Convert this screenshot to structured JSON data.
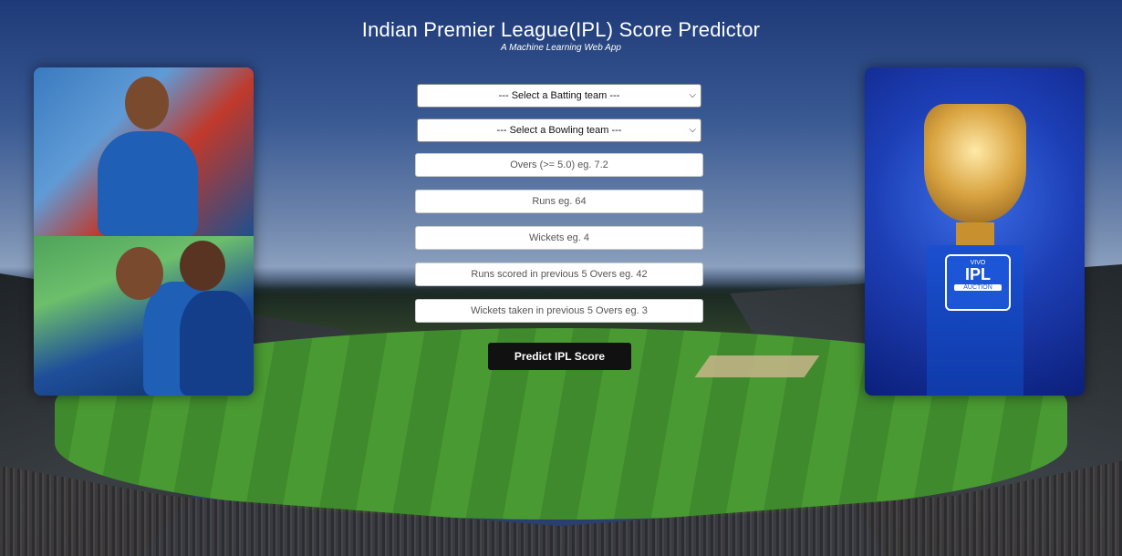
{
  "header": {
    "title": "Indian Premier League(IPL) Score Predictor",
    "subtitle": "A Machine Learning Web App"
  },
  "form": {
    "batting_select": "--- Select a Batting team ---",
    "bowling_select": "--- Select a Bowling team ---",
    "overs_placeholder": "Overs (>= 5.0) eg. 7.2",
    "runs_placeholder": "Runs eg. 64",
    "wickets_placeholder": "Wickets eg. 4",
    "runs_prev_placeholder": "Runs scored in previous 5 Overs eg. 42",
    "wickets_prev_placeholder": "Wickets taken in previous 5 Overs eg. 3",
    "submit_label": "Predict IPL Score"
  },
  "right_image": {
    "badge_vivo": "VIVO",
    "badge_ipl": "IPL",
    "badge_auction": "AUCTION"
  }
}
